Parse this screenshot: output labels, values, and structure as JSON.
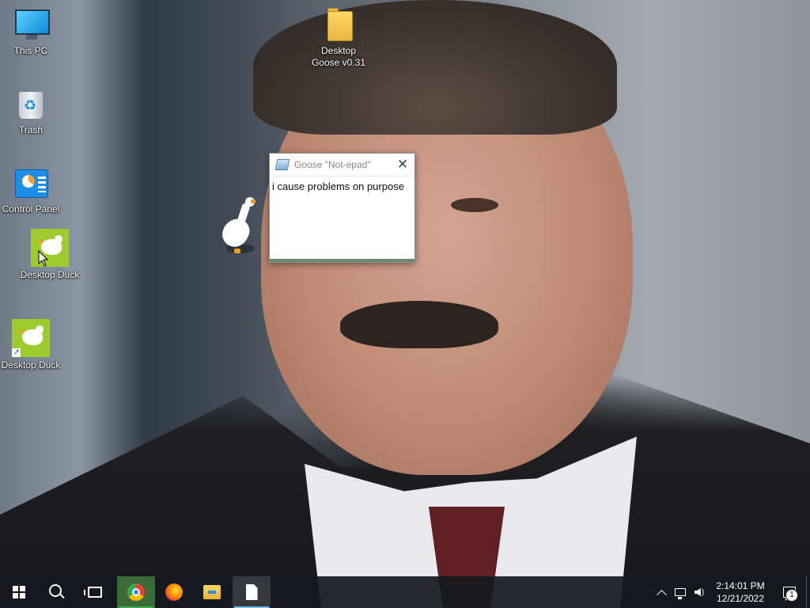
{
  "desktop_icons": [
    {
      "label": "This PC",
      "icon": "monitor-icon"
    },
    {
      "label": "Trash",
      "icon": "recycle-bin-icon"
    },
    {
      "label": "Control Panel",
      "icon": "control-panel-icon"
    },
    {
      "label": "Desktop\nGoose v0.31",
      "icon": "folder-icon"
    },
    {
      "label": "Desktop Duck",
      "icon": "duck-icon"
    },
    {
      "label": "Desktop Duck",
      "icon": "duck-shortcut-icon"
    }
  ],
  "notepad": {
    "title": "Goose \"Not-epad\"",
    "close_glyph": "✕",
    "content": "i cause problems on purpose"
  },
  "taskbar": {
    "start_icon": "windows-logo-icon",
    "search_icon": "search-icon",
    "task_view_icon": "task-view-icon",
    "pinned": [
      {
        "name": "Chrome",
        "icon": "chrome-icon"
      },
      {
        "name": "Firefox",
        "icon": "firefox-icon"
      },
      {
        "name": "File Explorer",
        "icon": "folder-icon"
      },
      {
        "name": "Notepad",
        "icon": "document-icon"
      }
    ],
    "tray": {
      "time": "2:14:01 PM",
      "date": "12/21/2022",
      "notification_count": "1"
    }
  },
  "colors": {
    "taskbar_bg": "#161a1e",
    "active_underline": "#76b9ed",
    "duck_tile": "#9ecc2f"
  }
}
